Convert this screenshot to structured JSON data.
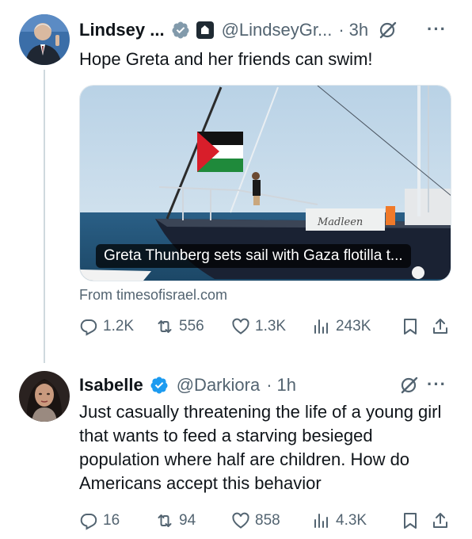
{
  "tweets": [
    {
      "author_name": "Lindsey ...",
      "handle": "@LindseyGr...",
      "separator": "·",
      "time": "3h",
      "text": "Hope Greta and her friends can swim!",
      "card": {
        "caption": "Greta Thunberg sets sail with Gaza flotilla t...",
        "source": "From timesofisrael.com",
        "boat_label": "Madleen"
      },
      "stats": {
        "replies": "1.2K",
        "reposts": "556",
        "likes": "1.3K",
        "views": "243K"
      },
      "badges": [
        "verified-badge",
        "government-badge"
      ]
    },
    {
      "author_name": "Isabelle",
      "handle": "@Darkiora",
      "separator": "·",
      "time": "1h",
      "text": "Just casually threatening the life of a young girl that wants to feed a starving besieged population where half are children. How do Americans accept this behavior",
      "stats": {
        "replies": "16",
        "reposts": "94",
        "likes": "858",
        "views": "4.3K"
      },
      "badges": [
        "verified-badge"
      ]
    }
  ],
  "colors": {
    "verified_blue": "#1d9bf0",
    "muted_text": "#536471",
    "text": "#0f1419",
    "thread_line": "#cfd9de"
  }
}
